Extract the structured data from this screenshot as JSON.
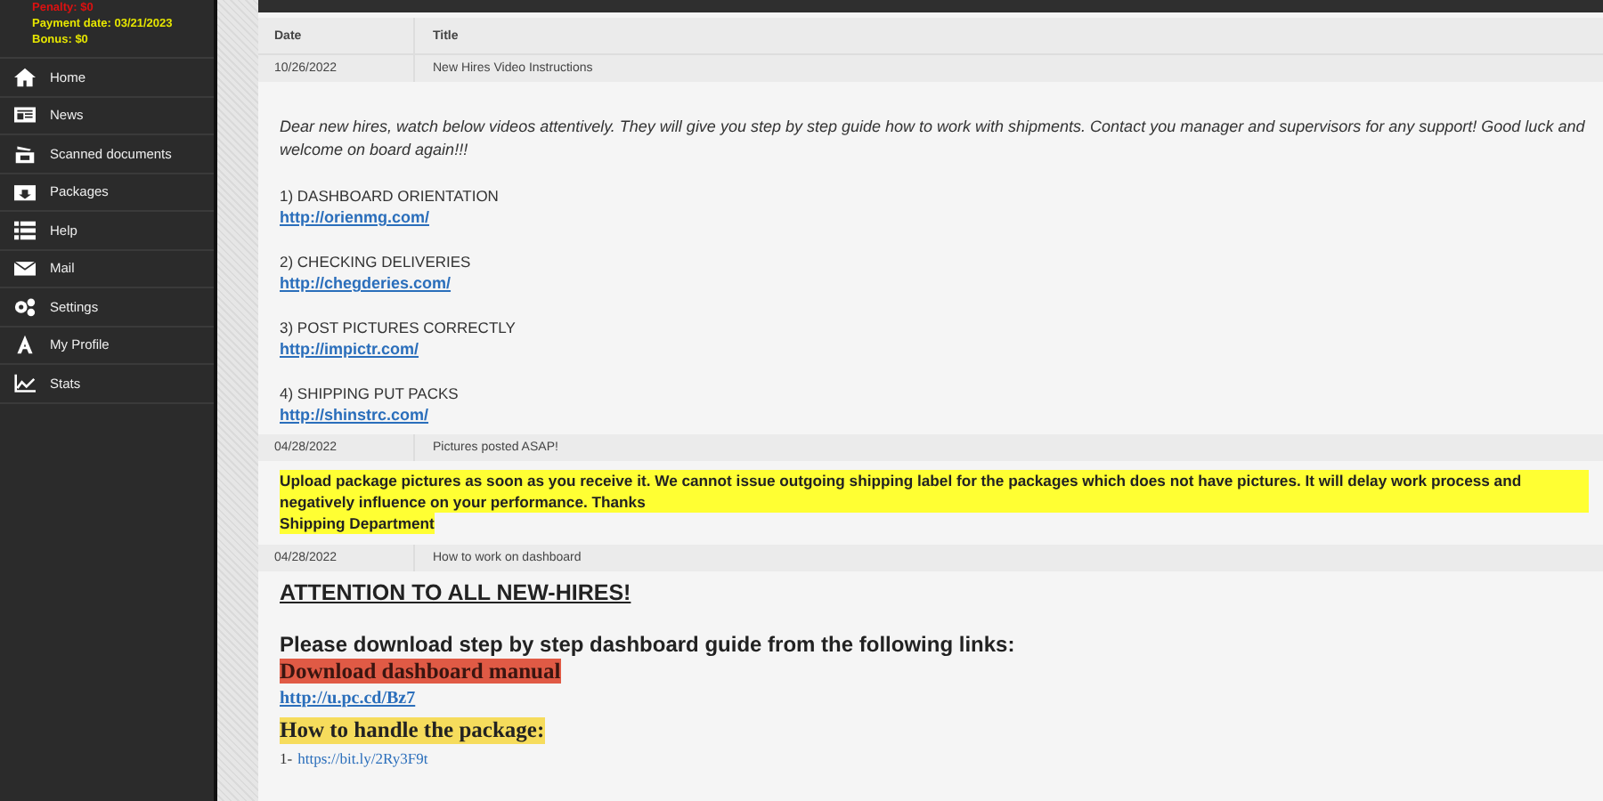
{
  "sidebar": {
    "stats": [
      {
        "kind": "penalty",
        "text": "Penalty: $0"
      },
      {
        "kind": "payment",
        "text": "Payment date: 03/21/2023"
      },
      {
        "kind": "bonus",
        "text": "Bonus: $0"
      }
    ],
    "items": [
      {
        "label": "Home"
      },
      {
        "label": "News"
      },
      {
        "label": "Scanned documents"
      },
      {
        "label": "Packages"
      },
      {
        "label": "Help"
      },
      {
        "label": "Mail"
      },
      {
        "label": "Settings"
      },
      {
        "label": "My Profile"
      },
      {
        "label": "Stats"
      }
    ]
  },
  "table": {
    "columns": [
      "Date",
      "Title"
    ],
    "posts": [
      {
        "date": "10/26/2022",
        "title": "New Hires Video Instructions",
        "body": [
          {
            "kind": "intro",
            "text": "Dear new hires, watch below videos attentively. They will give you step by step guide how to work with shipments. Contact you manager and supervisors for any support! Good luck and welcome on board again!!!"
          },
          {
            "kind": "heading",
            "text": "1) DASHBOARD ORIENTATION"
          },
          {
            "kind": "link",
            "text": "http://orienmg.com/"
          },
          {
            "kind": "heading",
            "text": "2) CHECKING DELIVERIES"
          },
          {
            "kind": "link",
            "text": "http://chegderies.com/"
          },
          {
            "kind": "heading",
            "text": "3) POST PICTURES CORRECTLY"
          },
          {
            "kind": "link",
            "text": "http://impictr.com/"
          },
          {
            "kind": "heading",
            "text": "4) SHIPPING PUT PACKS"
          },
          {
            "kind": "link",
            "text": "http://shinstrc.com/"
          }
        ]
      },
      {
        "date": "04/28/2022",
        "title": "Pictures posted ASAP!",
        "body": [
          {
            "kind": "highlight",
            "text": "Upload package pictures as soon as you receive it. We cannot issue outgoing shipping label for the packages which does not have pictures. It will delay work process and negatively influence on your performance. Thanks"
          },
          {
            "kind": "highlight",
            "text": "Shipping Department"
          }
        ]
      },
      {
        "date": "04/28/2022",
        "title": "How to work on dashboard",
        "body": [
          {
            "kind": "attention",
            "text": "ATTENTION TO ALL NEW-HIRES!"
          },
          {
            "kind": "subheading",
            "text": "Please download step by step dashboard guide from the following links:"
          },
          {
            "kind": "red-banner",
            "text": "Download dashboard manual"
          },
          {
            "kind": "serif-link",
            "text": "http://u.pc.cd/Bz7"
          },
          {
            "kind": "yellow-banner",
            "text": "How to handle the package:"
          },
          {
            "kind": "list-link",
            "prefix": "1-",
            "text": "https://bit.ly/2Ry3F9t"
          }
        ]
      }
    ]
  }
}
